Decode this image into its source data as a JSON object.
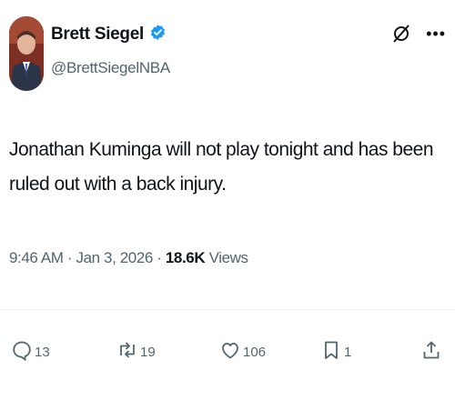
{
  "author": {
    "display_name": "Brett Siegel",
    "handle": "@BrettSiegelNBA",
    "verified": true,
    "verified_color": "#1d9bf0"
  },
  "tweet": {
    "text": "Jonathan Kuminga will not play tonight and has been ruled out with a back injury.",
    "time": "9:46 AM",
    "separator": "·",
    "date": "Jan 3, 2026",
    "views_count": "18.6K",
    "views_label": "Views"
  },
  "actions": {
    "replies": "13",
    "reposts": "19",
    "likes": "106",
    "bookmarks": "1"
  },
  "icons": [
    "grok-icon",
    "more-icon",
    "reply-icon",
    "repost-icon",
    "like-icon",
    "bookmark-icon",
    "share-icon",
    "verified-badge-icon"
  ]
}
